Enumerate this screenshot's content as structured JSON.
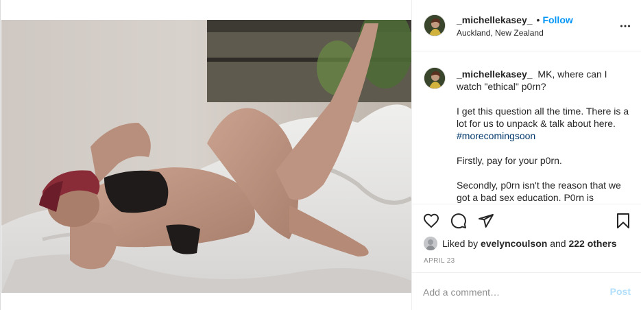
{
  "post": {
    "username": "_michellekasey_",
    "follow_label": "Follow",
    "separator": "•",
    "location": "Auckland, New Zealand",
    "more_icon": "more-horizontal-icon",
    "media_alt": "",
    "caption": {
      "username": "_michellekasey_",
      "line1": "MK, where can I watch \"ethical\" p0rn?",
      "line2_text": "I get this question all the time. There is a lot for us to unpack & talk about here.",
      "hashtag": "#morecomingsoon",
      "line3": "Firstly, pay for your p0rn.",
      "line4": "Secondly, p0rn isn't the reason that we got a bad sex education. P0rn is"
    },
    "actions": {
      "like_icon": "heart-icon",
      "comment_icon": "comment-icon",
      "share_icon": "share-icon",
      "save_icon": "bookmark-icon"
    },
    "likes": {
      "prefix": "Liked by",
      "user": "evelyncoulson",
      "conjunction": "and",
      "others": "222 others"
    },
    "date": "APRIL 23",
    "comment": {
      "placeholder": "Add a comment…",
      "post_label": "Post"
    },
    "colors": {
      "link_blue": "#0095f6",
      "hashtag": "#00376b",
      "post_disabled": "#b2dffc",
      "muted": "#8e8e8e"
    }
  }
}
